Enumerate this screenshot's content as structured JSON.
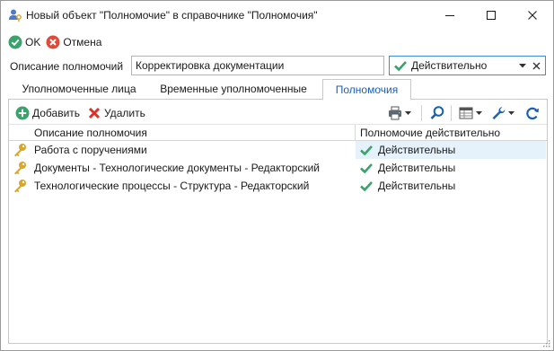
{
  "window": {
    "title": "Новый объект \"Полномочие\" в справочнике \"Полномочия\"",
    "icon": "users-key-icon"
  },
  "actions": {
    "ok_label": "OK",
    "cancel_label": "Отмена"
  },
  "form": {
    "description_label": "Описание полномочий",
    "description_value": "Корректировка документации",
    "status_value": "Действительно"
  },
  "tabs": [
    {
      "label": "Уполномоченные лица",
      "active": false
    },
    {
      "label": "Временные уполномоченные",
      "active": false
    },
    {
      "label": "Полномочия",
      "active": true
    }
  ],
  "toolbar": {
    "add_label": "Добавить",
    "delete_label": "Удалить"
  },
  "grid": {
    "columns": [
      "Описание полномочия",
      "Полномочие действительно"
    ],
    "rows": [
      {
        "description": "Работа с поручениями",
        "status": "Действительны"
      },
      {
        "description": "Документы - Технологические документы - Редакторский",
        "status": "Действительны"
      },
      {
        "description": "Технологические процессы - Структура - Редакторский",
        "status": "Действительны"
      }
    ]
  },
  "colors": {
    "accent": "#1b5fb4",
    "ok_green": "#3aa26b",
    "cancel_red": "#e04a3a",
    "selected_cell": "#e5f1fb",
    "key_gold": "#d9a52a"
  }
}
